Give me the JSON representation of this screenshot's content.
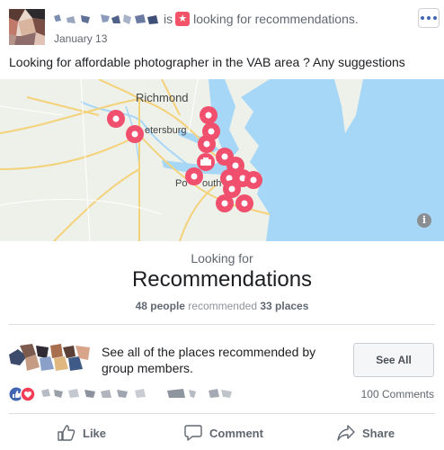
{
  "post": {
    "status_prefix": "is",
    "status_text": "looking for recommendations.",
    "badge_glyph": "★",
    "date": "January 13",
    "text": "Looking for affordable photographer in the VAB area ? Any suggestions"
  },
  "map": {
    "labels": {
      "richmond": "Richmond",
      "petersburg": "etersburg",
      "portsmouth": "Po",
      "portsmouth_suffix": "outh"
    },
    "info_glyph": "i",
    "colors": {
      "water": "#a7d7f6",
      "land": "#eef0ea",
      "road": "#f4d27a",
      "pin": "#f0506e"
    }
  },
  "recommendations": {
    "looking_for": "Looking for",
    "title": "Recommendations",
    "people_count": "48 people",
    "middle": "recommended",
    "places_count": "33 places"
  },
  "see_all": {
    "description": "See all of the places recommended by group members.",
    "button_label": "See All"
  },
  "engagement": {
    "comments": "100 Comments"
  },
  "actions": {
    "like": "Like",
    "comment": "Comment",
    "share": "Share"
  },
  "colors": {
    "accent": "#4267b2",
    "love": "#f33e58",
    "badge": "#f35369"
  }
}
